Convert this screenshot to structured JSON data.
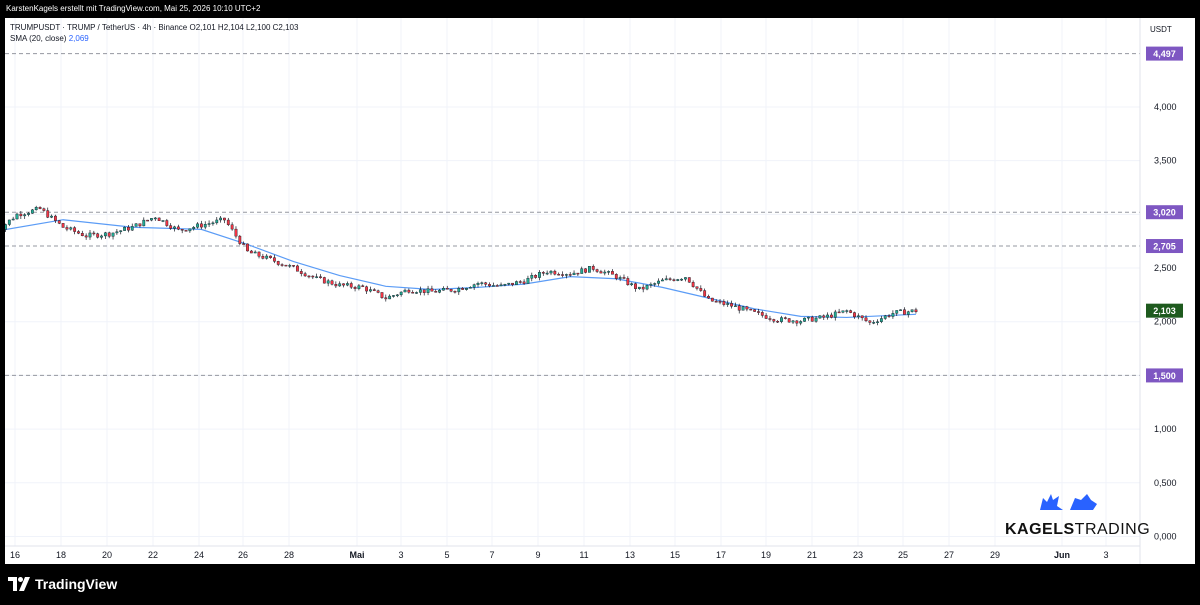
{
  "header": {
    "attribution": "KarstenKagels erstellt mit TradingView.com, Mai 25, 2026 10:10 UTC+2"
  },
  "legend": {
    "symbol_line": "TRUMPUSDT · TRUMP / TetherUS · 4h · Binance",
    "ohlc": "O2,101  H2,104  L2,100  C2,103",
    "sma_label": "SMA (20, close)",
    "sma_value": "2,069"
  },
  "axis": {
    "currency": "USDT"
  },
  "footer": {
    "logo_text": "TradingView"
  },
  "brand": {
    "bold": "KAGELS",
    "light": "TRADING"
  },
  "colors": {
    "up": "#22ab94",
    "down": "#f23645",
    "sma": "#5b9cf6",
    "level": "#7e57c2",
    "current": "#1e5a1e",
    "bull_bear_logo": "#2962ff"
  },
  "chart_data": {
    "type": "candlestick",
    "title": "TRUMPUSDT · TRUMP / TetherUS · 4h · Binance",
    "ylabel": "USDT",
    "ylim": [
      0,
      4.75
    ],
    "y_ticks": [
      "0,000",
      "0,500",
      "1,000",
      "1,500",
      "2,000",
      "2,500",
      "3,000",
      "3,500",
      "4,000"
    ],
    "x_ticks": [
      "16",
      "18",
      "20",
      "22",
      "24",
      "26",
      "28",
      "Mai",
      "3",
      "5",
      "7",
      "9",
      "11",
      "13",
      "15",
      "17",
      "19",
      "21",
      "23",
      "25",
      "27",
      "29",
      "Jun",
      "3"
    ],
    "grid": true,
    "horizontal_levels": [
      {
        "value": 4.497,
        "label": "4,497"
      },
      {
        "value": 3.02,
        "label": "3,020"
      },
      {
        "value": 2.705,
        "label": "2,705"
      },
      {
        "value": 1.5,
        "label": "1,500"
      }
    ],
    "last_price": {
      "value": 2.103,
      "label": "2,103"
    },
    "series": [
      {
        "name": "TRUMPUSDT",
        "kind": "close_path",
        "x": [
          "Apr 15",
          "Apr 16",
          "Apr 17",
          "Apr 18",
          "Apr 19",
          "Apr 20",
          "Apr 21",
          "Apr 22",
          "Apr 23",
          "Apr 24",
          "Apr 25",
          "Apr 26",
          "Apr 27",
          "Apr 28",
          "Apr 29",
          "Apr 30",
          "May 1",
          "May 2",
          "May 3",
          "May 4",
          "May 5",
          "May 6",
          "May 7",
          "May 8",
          "May 9",
          "May 10",
          "May 11",
          "May 12",
          "May 13",
          "May 14",
          "May 15",
          "May 16",
          "May 17",
          "May 18",
          "May 19",
          "May 20",
          "May 21",
          "May 22",
          "May 23",
          "May 24",
          "May 25"
        ],
        "values": [
          2.82,
          3.0,
          3.05,
          2.88,
          2.8,
          2.82,
          2.88,
          2.98,
          2.85,
          2.9,
          2.95,
          2.65,
          2.58,
          2.5,
          2.4,
          2.34,
          2.32,
          2.22,
          2.3,
          2.28,
          2.3,
          2.36,
          2.33,
          2.38,
          2.47,
          2.45,
          2.5,
          2.42,
          2.3,
          2.38,
          2.42,
          2.2,
          2.15,
          2.08,
          2.02,
          2.01,
          2.04,
          2.1,
          1.99,
          2.08,
          2.103
        ]
      },
      {
        "name": "SMA (20, close)",
        "kind": "line",
        "x": [
          "Apr 15",
          "Apr 18",
          "Apr 21",
          "Apr 24",
          "Apr 26",
          "Apr 28",
          "Apr 30",
          "May 2",
          "May 4",
          "May 6",
          "May 8",
          "May 10",
          "May 12",
          "May 14",
          "May 16",
          "May 18",
          "May 20",
          "May 22",
          "May 24",
          "May 25"
        ],
        "values": [
          2.84,
          2.95,
          2.88,
          2.86,
          2.72,
          2.56,
          2.43,
          2.33,
          2.3,
          2.32,
          2.35,
          2.42,
          2.4,
          2.32,
          2.22,
          2.12,
          2.05,
          2.04,
          2.06,
          2.069
        ]
      }
    ]
  }
}
